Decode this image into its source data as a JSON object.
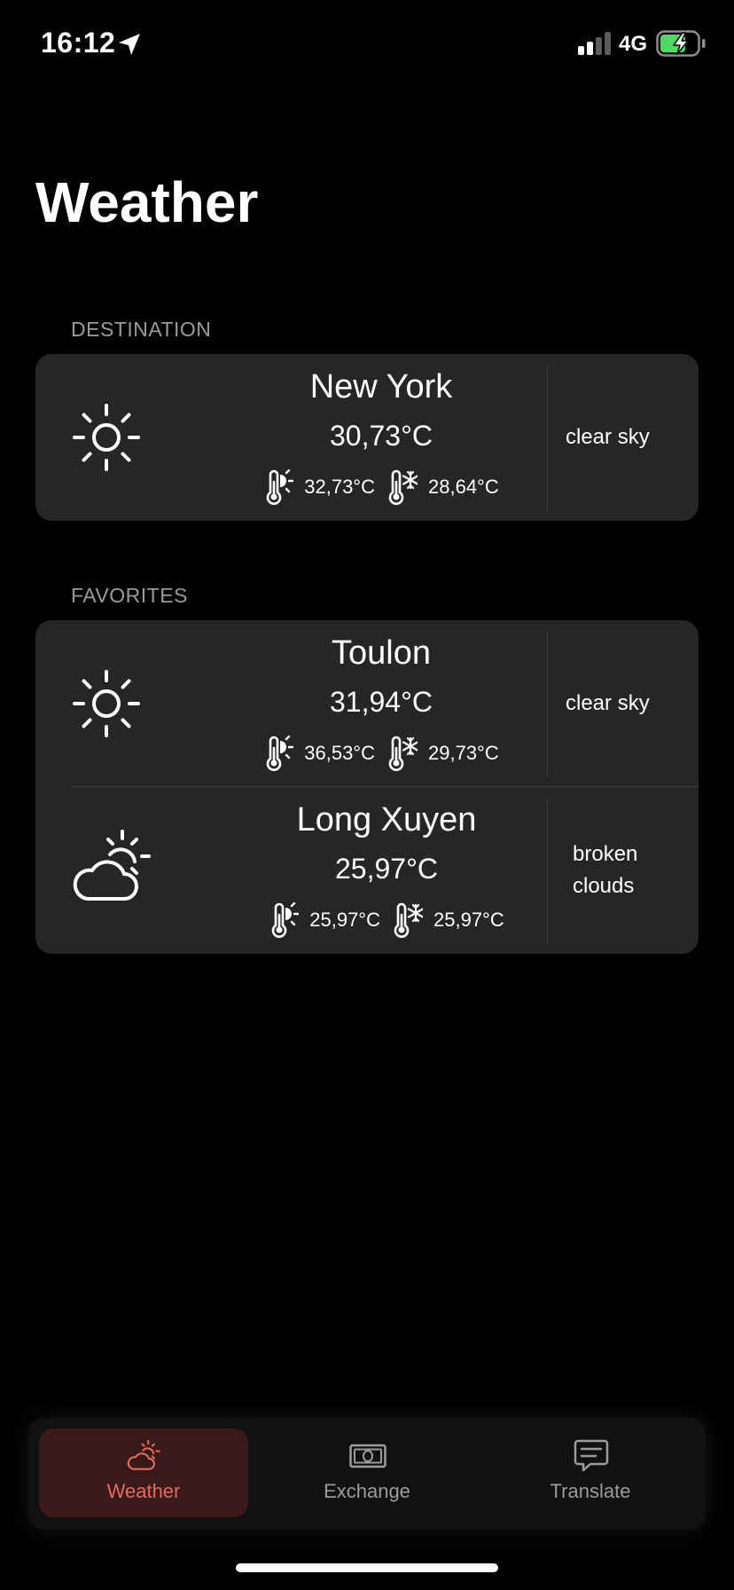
{
  "status_bar": {
    "time": "16:12",
    "network": "4G",
    "icons": [
      "location-arrow-icon",
      "signal-icon",
      "battery-charging-icon"
    ],
    "battery_color": "#4cd964"
  },
  "title": "Weather",
  "destination": {
    "header": "DESTINATION",
    "items": [
      {
        "city": "New York",
        "temp": "30,73°C",
        "max": "32,73°C",
        "min": "28,64°C",
        "description": "clear sky",
        "icon": "sun-icon"
      }
    ]
  },
  "favorites": {
    "header": "FAVORITES",
    "items": [
      {
        "city": "Toulon",
        "temp": "31,94°C",
        "max": "36,53°C",
        "min": "29,73°C",
        "description": "clear sky",
        "icon": "sun-icon"
      },
      {
        "city": "Long Xuyen",
        "temp": "25,97°C",
        "max": "25,97°C",
        "min": "25,97°C",
        "description": "broken clouds",
        "icon": "cloud-sun-icon"
      }
    ]
  },
  "tab_bar": {
    "tabs": [
      {
        "label": "Weather",
        "icon": "cloud-sun-icon",
        "active": true
      },
      {
        "label": "Exchange",
        "icon": "banknote-icon",
        "active": false
      },
      {
        "label": "Translate",
        "icon": "chat-bubble-icon",
        "active": false
      }
    ],
    "active_color": "#e36b5e",
    "inactive_color": "#9b9b9f"
  }
}
